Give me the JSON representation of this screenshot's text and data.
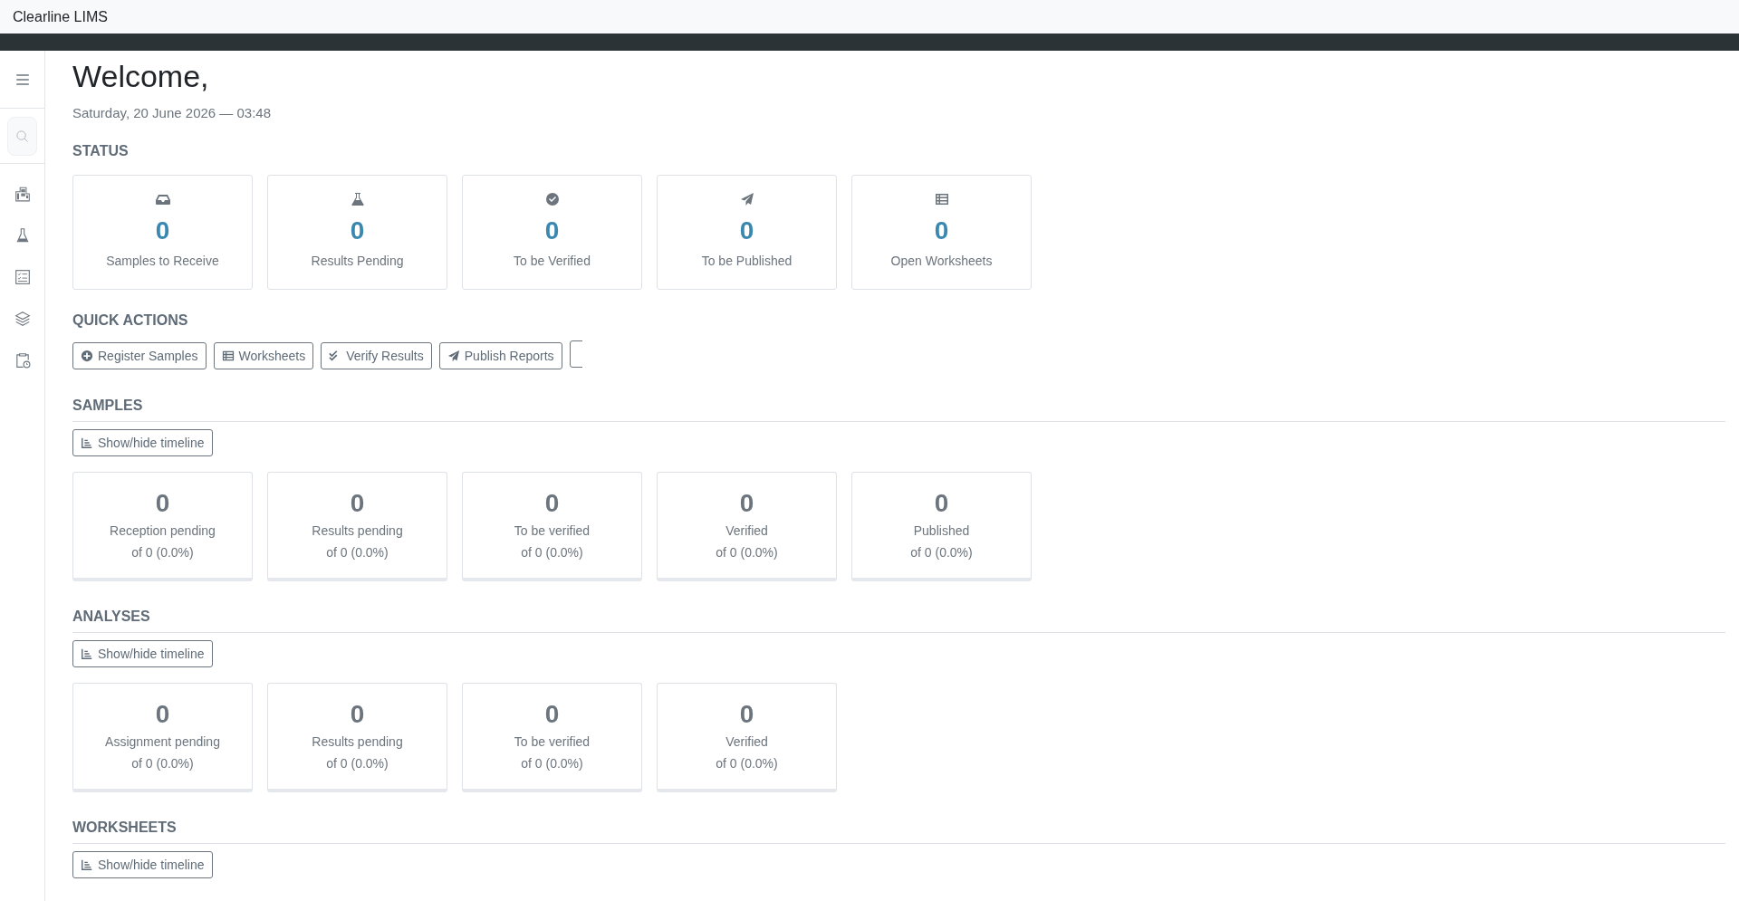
{
  "app": {
    "title": "Clearline LIMS"
  },
  "welcome": {
    "heading": "Welcome,",
    "date": "Saturday, 20 June 2026 — 03:48"
  },
  "status": {
    "title": "STATUS",
    "cards": [
      {
        "kind": "inbox",
        "value": "0",
        "label": "Samples to Receive"
      },
      {
        "kind": "flask",
        "value": "0",
        "label": "Results Pending"
      },
      {
        "kind": "check",
        "value": "0",
        "label": "To be Verified"
      },
      {
        "kind": "send",
        "value": "0",
        "label": "To be Published"
      },
      {
        "kind": "list",
        "value": "0",
        "label": "Open Worksheets"
      }
    ]
  },
  "quick_actions": {
    "title": "QUICK ACTIONS",
    "buttons": [
      {
        "kind": "plus",
        "label": "Register Samples"
      },
      {
        "kind": "list",
        "label": "Worksheets"
      },
      {
        "kind": "checks",
        "label": "Verify Results"
      },
      {
        "kind": "send",
        "label": "Publish Reports"
      }
    ]
  },
  "sections": [
    {
      "title": "SAMPLES",
      "toggle": "Show/hide timeline",
      "cards": [
        {
          "value": "0",
          "label": "Reception pending",
          "of": "of 0 (0.0%)"
        },
        {
          "value": "0",
          "label": "Results pending",
          "of": "of 0 (0.0%)"
        },
        {
          "value": "0",
          "label": "To be verified",
          "of": "of 0 (0.0%)"
        },
        {
          "value": "0",
          "label": "Verified",
          "of": "of 0 (0.0%)"
        },
        {
          "value": "0",
          "label": "Published",
          "of": "of 0 (0.0%)"
        }
      ]
    },
    {
      "title": "ANALYSES",
      "toggle": "Show/hide timeline",
      "cards": [
        {
          "value": "0",
          "label": "Assignment pending",
          "of": "of 0 (0.0%)"
        },
        {
          "value": "0",
          "label": "Results pending",
          "of": "of 0 (0.0%)"
        },
        {
          "value": "0",
          "label": "To be verified",
          "of": "of 0 (0.0%)"
        },
        {
          "value": "0",
          "label": "Verified",
          "of": "of 0 (0.0%)"
        }
      ]
    },
    {
      "title": "WORKSHEETS",
      "toggle": "Show/hide timeline"
    }
  ]
}
